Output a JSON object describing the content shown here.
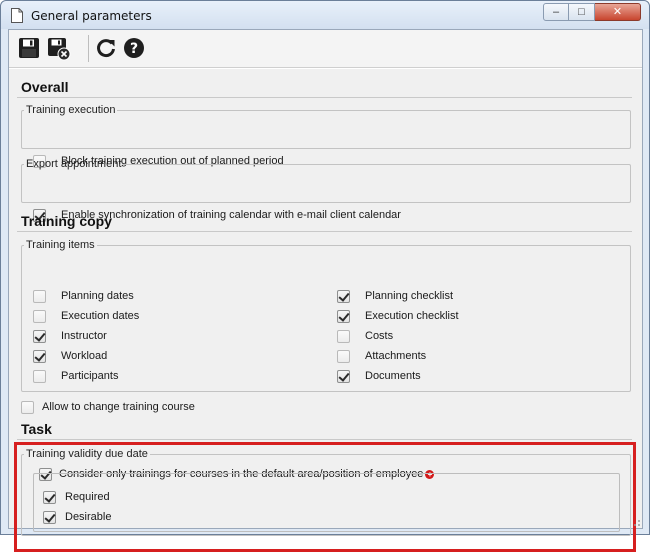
{
  "window": {
    "title": "General parameters",
    "controls": {
      "minimize": "–",
      "maximize": "□",
      "close": "✕"
    }
  },
  "toolbar": {
    "buttons": [
      {
        "name": "save-button",
        "icon": "floppy-disk-icon",
        "tooltip": ""
      },
      {
        "name": "save-and-close-button",
        "icon": "floppy-disk-close-icon",
        "tooltip": ""
      },
      {
        "name": "refresh-button",
        "icon": "refresh-icon",
        "tooltip": ""
      },
      {
        "name": "help-button",
        "icon": "help-icon",
        "tooltip": ""
      }
    ]
  },
  "sections": {
    "overall": {
      "title": "Overall",
      "training_execution": {
        "legend": "Training execution",
        "block_label": "Block training execution out of planned period",
        "block_checked": false
      },
      "export_appointment": {
        "legend": "Export appointment",
        "sync_label": "Enable synchronization of training calendar with e-mail client calendar",
        "sync_checked": true
      }
    },
    "training_copy": {
      "title": "Training copy",
      "training_items": {
        "legend": "Training items",
        "left": [
          {
            "label": "Planning dates",
            "checked": false
          },
          {
            "label": "Execution dates",
            "checked": false
          },
          {
            "label": "Instructor",
            "checked": true
          },
          {
            "label": "Workload",
            "checked": true
          },
          {
            "label": "Participants",
            "checked": false
          }
        ],
        "right": [
          {
            "label": "Planning checklist",
            "checked": true
          },
          {
            "label": "Execution checklist",
            "checked": true
          },
          {
            "label": "Costs",
            "checked": false
          },
          {
            "label": "Attachments",
            "checked": false
          },
          {
            "label": "Documents",
            "checked": true
          }
        ]
      },
      "allow_change_label": "Allow to change training course",
      "allow_change_checked": false
    },
    "task": {
      "title": "Task",
      "validity": {
        "legend": "Training validity due date",
        "consider_label": "Consider only trainings for courses in the default area/position of employee",
        "consider_checked": true,
        "required_label": "Required",
        "required_checked": true,
        "desirable_label": "Desirable",
        "desirable_checked": true
      }
    }
  },
  "colors": {
    "highlight": "#d61f1f",
    "required_marker": "#d21a1a",
    "window_frame": "#dfe9f5",
    "close_button": "#c8452e"
  }
}
